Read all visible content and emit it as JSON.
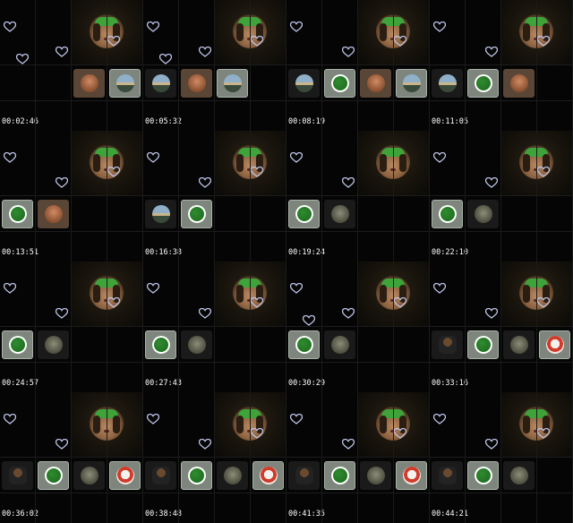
{
  "frames": [
    {
      "time": "00:02:46",
      "tiles": [
        {
          "kind": "person",
          "style": "warm"
        },
        {
          "kind": "scene",
          "style": "sel"
        }
      ],
      "hearts": [
        [
          2,
          26
        ],
        [
          64,
          52
        ],
        [
          4,
          66
        ],
        [
          12,
          68
        ]
      ]
    },
    {
      "time": "00:05:32",
      "tiles": [
        {
          "kind": "scene",
          "style": "dim"
        },
        {
          "kind": "person",
          "style": "warm"
        },
        {
          "kind": "scene",
          "style": "sel"
        }
      ],
      "hearts": [
        [
          14,
          4
        ],
        [
          30,
          32
        ],
        [
          2,
          18
        ],
        [
          10,
          38
        ]
      ]
    },
    {
      "time": "00:08:19",
      "tiles": [
        {
          "kind": "scene",
          "style": "dim"
        },
        {
          "kind": "globe",
          "style": "sel"
        },
        {
          "kind": "person",
          "style": "warm"
        },
        {
          "kind": "scene",
          "style": "sel"
        }
      ],
      "hearts": [
        [
          0,
          20
        ],
        [
          66,
          42
        ],
        [
          6,
          60
        ]
      ]
    },
    {
      "time": "00:11:05",
      "tiles": [
        {
          "kind": "scene",
          "style": "dim"
        },
        {
          "kind": "globe",
          "style": "sel"
        },
        {
          "kind": "person",
          "style": "warm"
        }
      ],
      "hearts": [
        [
          0,
          24
        ],
        [
          64,
          48
        ],
        [
          4,
          66
        ]
      ]
    },
    {
      "time": "00:13:51",
      "tiles": [
        {
          "kind": "globe",
          "style": "sel"
        },
        {
          "kind": "person",
          "style": "warm"
        }
      ],
      "hearts": [
        [
          70,
          148
        ],
        [
          14,
          180
        ],
        [
          4,
          188
        ]
      ]
    },
    {
      "time": "00:16:38",
      "tiles": [
        {
          "kind": "scene",
          "style": "dim"
        },
        {
          "kind": "globe",
          "style": "sel"
        }
      ],
      "hearts": [
        [
          6,
          172
        ],
        [
          64,
          196
        ],
        [
          14,
          212
        ]
      ]
    },
    {
      "time": "00:19:24",
      "tiles": [
        {
          "kind": "globe",
          "style": "sel"
        },
        {
          "kind": "stone",
          "style": "dim"
        }
      ],
      "hearts": [
        [
          18,
          148
        ],
        [
          66,
          184
        ]
      ]
    },
    {
      "time": "00:22:10",
      "tiles": [
        {
          "kind": "globe",
          "style": "sel"
        },
        {
          "kind": "stone",
          "style": "dim"
        }
      ],
      "hearts": [
        [
          2,
          148
        ],
        [
          66,
          176
        ],
        [
          6,
          190
        ]
      ]
    },
    {
      "time": "00:24:57",
      "tiles": [
        {
          "kind": "globe",
          "style": "sel"
        },
        {
          "kind": "stone",
          "style": "dim"
        }
      ],
      "hearts": [
        [
          56,
          294
        ],
        [
          66,
          306
        ],
        [
          16,
          342
        ]
      ]
    },
    {
      "time": "00:27:43",
      "tiles": [
        {
          "kind": "globe",
          "style": "sel"
        },
        {
          "kind": "stone",
          "style": "dim"
        }
      ],
      "hearts": [
        [
          60,
          292
        ],
        [
          6,
          328
        ],
        [
          66,
          356
        ]
      ]
    },
    {
      "time": "00:30:29",
      "tiles": [
        {
          "kind": "globe",
          "style": "sel"
        },
        {
          "kind": "stone",
          "style": "dim"
        }
      ],
      "hearts": [
        [
          54,
          296
        ],
        [
          4,
          312
        ],
        [
          14,
          336
        ],
        [
          66,
          320
        ]
      ]
    },
    {
      "time": "00:33:16",
      "tiles": [
        {
          "kind": "guy",
          "style": "dim"
        },
        {
          "kind": "globe",
          "style": "sel"
        },
        {
          "kind": "stone",
          "style": "dim"
        },
        {
          "kind": "pizza",
          "style": "sel"
        }
      ],
      "hearts": [
        [
          56,
          300
        ],
        [
          2,
          316
        ],
        [
          14,
          360
        ]
      ]
    },
    {
      "time": "00:36:02",
      "tiles": [
        {
          "kind": "guy",
          "style": "dim"
        },
        {
          "kind": "globe",
          "style": "sel"
        },
        {
          "kind": "stone",
          "style": "dim"
        },
        {
          "kind": "pizza",
          "style": "sel"
        }
      ],
      "hearts": [
        [
          12,
          436
        ],
        [
          66,
          476
        ]
      ]
    },
    {
      "time": "00:38:48",
      "tiles": [
        {
          "kind": "guy",
          "style": "dim"
        },
        {
          "kind": "globe",
          "style": "sel"
        },
        {
          "kind": "stone",
          "style": "dim"
        },
        {
          "kind": "pizza",
          "style": "sel"
        }
      ],
      "hearts": [
        [
          58,
          468
        ],
        [
          2,
          488
        ],
        [
          68,
          496
        ]
      ]
    },
    {
      "time": "00:41:35",
      "tiles": [
        {
          "kind": "guy",
          "style": "dim"
        },
        {
          "kind": "globe",
          "style": "sel"
        },
        {
          "kind": "stone",
          "style": "dim"
        },
        {
          "kind": "pizza",
          "style": "sel"
        }
      ],
      "hearts": [
        [
          4,
          444
        ],
        [
          14,
          448
        ],
        [
          62,
          488
        ]
      ]
    },
    {
      "time": "00:44:21",
      "tiles": [
        {
          "kind": "guy",
          "style": "dim"
        },
        {
          "kind": "globe",
          "style": "sel"
        },
        {
          "kind": "stone",
          "style": "dim"
        }
      ],
      "hearts": [
        [
          2,
          458
        ],
        [
          64,
          484
        ],
        [
          6,
          500
        ]
      ]
    }
  ]
}
